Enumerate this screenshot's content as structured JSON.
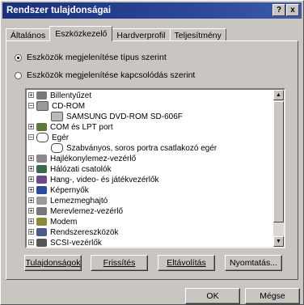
{
  "window": {
    "title": "Rendszer tulajdonságai",
    "help_glyph": "?",
    "close_glyph": "x"
  },
  "tabs": [
    {
      "label": "Általános"
    },
    {
      "label": "Eszközkezelő"
    },
    {
      "label": "Hardverprofil"
    },
    {
      "label": "Teljesítmény"
    }
  ],
  "view_options": [
    {
      "label": "Eszközök megjelenítése típus szerint",
      "selected": true
    },
    {
      "label": "Eszközök megjelenítése kapcsolódás szerint",
      "selected": false
    }
  ],
  "tree": [
    {
      "label": "Billentyűzet",
      "icon": "keyboard-icon"
    },
    {
      "label": "CD-ROM",
      "icon": "cdrom-icon"
    },
    {
      "label": "SAMSUNG DVD-ROM SD-606F",
      "icon": "cdrom-drive-icon"
    },
    {
      "label": "COM és LPT port",
      "icon": "port-icon"
    },
    {
      "label": "Egér",
      "icon": "mouse-icon"
    },
    {
      "label": "Szabványos, soros portra csatlakozó egér",
      "icon": "mouse-icon"
    },
    {
      "label": "Hajlékonylemez-vezérlő",
      "icon": "floppy-controller-icon"
    },
    {
      "label": "Hálózati csatolók",
      "icon": "network-adapter-icon"
    },
    {
      "label": "Hang-, video- és játékvezérlők",
      "icon": "sound-icon"
    },
    {
      "label": "Képernyők",
      "icon": "monitor-icon"
    },
    {
      "label": "Lemezmeghajtó",
      "icon": "disk-drive-icon"
    },
    {
      "label": "Merevlemez-vezérlő",
      "icon": "hdd-controller-icon"
    },
    {
      "label": "Modem",
      "icon": "modem-icon"
    },
    {
      "label": "Rendszereszközök",
      "icon": "system-devices-icon"
    },
    {
      "label": "SCSI-vezérlők",
      "icon": "scsi-icon"
    }
  ],
  "actions": {
    "properties": "Tulajdonságok",
    "refresh": "Frissítés",
    "remove": "Eltávolítás",
    "print": "Nyomtatás..."
  },
  "dialog": {
    "ok": "OK",
    "cancel": "Mégse"
  },
  "colors": {
    "title_bar": "#1b2f7a",
    "face": "#c9c6c2"
  }
}
